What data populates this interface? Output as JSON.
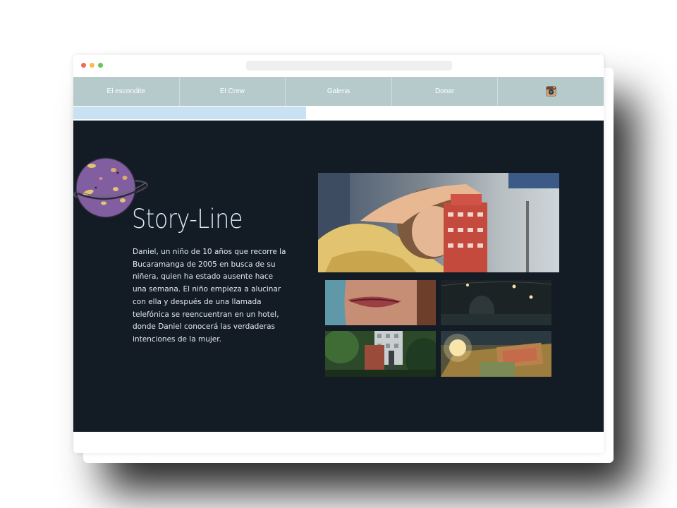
{
  "nav": {
    "items": [
      {
        "label": "El escondite"
      },
      {
        "label": "El Crew"
      },
      {
        "label": "Galeria"
      },
      {
        "label": "Donar"
      }
    ],
    "instagram_icon": "instagram-icon"
  },
  "section": {
    "title": "Story-Line",
    "description": "Daniel, un niño de 10 años que recorre la Bucaramanga de 2005 en busca de su niñera, quien ha estado ausente hace una semana. El niño empieza a alucinar con ella y después de una llamada telefónica se reencuentran en un hotel, donde Daniel conocerá las verdaderas intenciones de la mujer."
  },
  "colors": {
    "nav_background": "#b6cacc",
    "content_background": "#131b25",
    "title_color": "#d9ecfa",
    "strip_accent": "#c8e2f3"
  },
  "icons": {
    "planet": "planet-illustration",
    "instagram": "instagram-icon"
  }
}
